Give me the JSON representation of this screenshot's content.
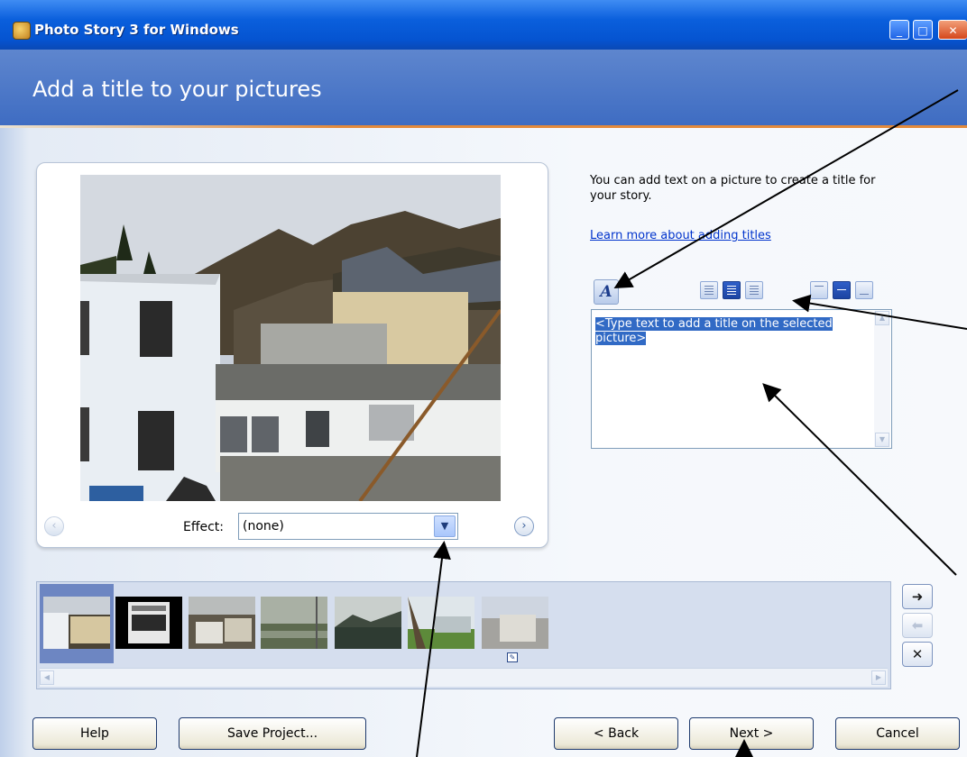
{
  "window": {
    "title": "Photo Story 3 for Windows"
  },
  "header": {
    "heading": "Add a title to your pictures"
  },
  "description": "You can add text on a picture to create a title for your story.",
  "learn_more": "Learn more about adding titles",
  "title_text": {
    "placeholder": "<Type text to add a title on the selected picture>"
  },
  "effect": {
    "label": "Effect:",
    "value": "(none)"
  },
  "buttons": {
    "help": "Help",
    "save_project": "Save Project...",
    "back": "< Back",
    "next": "Next >",
    "cancel": "Cancel"
  },
  "filmstrip": {
    "thumbnails": [
      "thumb-1",
      "thumb-2",
      "thumb-3",
      "thumb-4",
      "thumb-5",
      "thumb-6",
      "thumb-7"
    ],
    "selected_index": 0
  },
  "icons": {
    "font": "font-icon",
    "align_left": "align-left-icon",
    "align_center": "align-center-icon",
    "align_right": "align-right-icon",
    "valign_top": "valign-top-icon",
    "valign_middle": "valign-middle-icon",
    "valign_bottom": "valign-bottom-icon"
  },
  "colors": {
    "header_blue": "#4a75c6",
    "accent_orange": "#e38a3b",
    "selection_blue": "#316ac5"
  }
}
